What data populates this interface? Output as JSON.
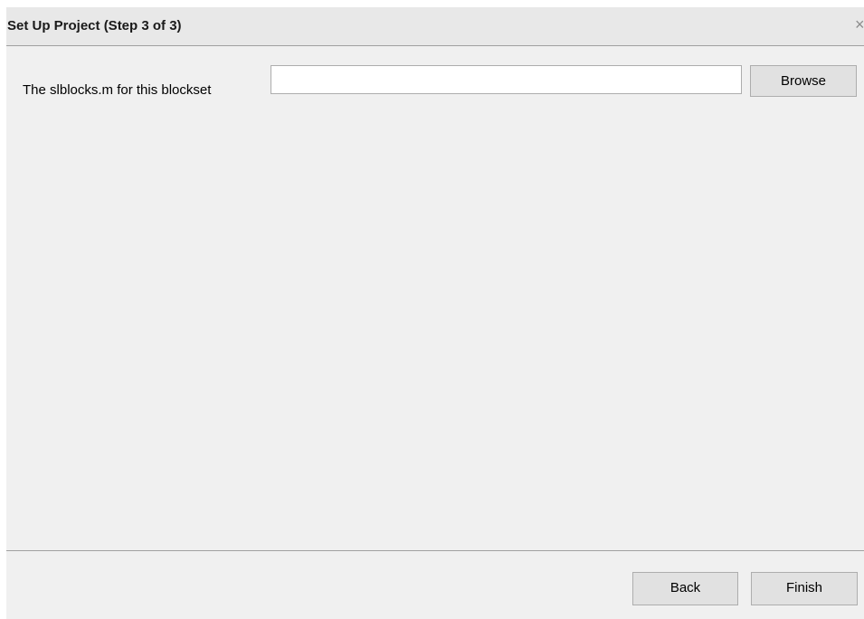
{
  "dialog": {
    "title": "Set Up Project (Step 3 of 3)",
    "close_glyph": "×"
  },
  "form": {
    "slblocks_label": "The slblocks.m for this blockset",
    "slblocks_value": "",
    "browse_label": "Browse"
  },
  "footer": {
    "back_label": "Back",
    "finish_label": "Finish"
  }
}
